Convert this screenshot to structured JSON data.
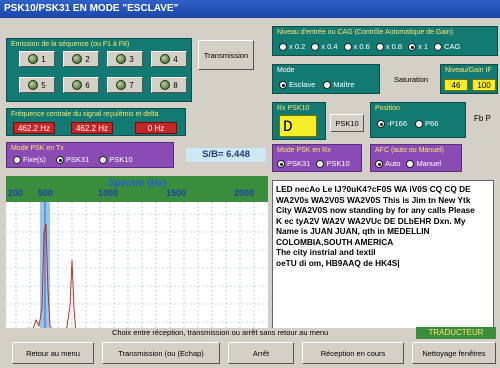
{
  "window": {
    "title": "PSK10/PSK31 EN MODE \"ESCLAVE\""
  },
  "seq": {
    "label": "Emission de la séquence (ou F1 à F8)",
    "buttons": [
      "1",
      "2",
      "3",
      "4",
      "5",
      "6",
      "7",
      "8"
    ],
    "transmission_btn": "Transmission"
  },
  "cag": {
    "label": "Niveau d'entrée ou CAG (Contrôle Automatique de Gain)",
    "options": [
      "x 0.2",
      "x 0.4",
      "x 0.6",
      "x 0.8",
      "x 1",
      "CAG"
    ],
    "selected": "x 1"
  },
  "freqpanel": {
    "label": "Fréquence centrale du signal reçu/émis et delta",
    "values": [
      "462.2 Hz",
      "462.2 Hz",
      "0 Hz"
    ]
  },
  "mode": {
    "label": "Mode",
    "options": [
      "Esclave",
      "Maître"
    ],
    "selected": "Esclave"
  },
  "saturation": "Saturation",
  "gain": {
    "label": "Niveau/Gain IF",
    "values": [
      "46",
      "100"
    ]
  },
  "rx": {
    "label": "Rx PSK10",
    "value": "D",
    "btn": "PSK10"
  },
  "position": {
    "label": "Position",
    "options": [
      "-P166",
      "P66"
    ],
    "selected": "-P166",
    "extra": "Fb P"
  },
  "txmode": {
    "label": "Mode PSK en Tx",
    "options": [
      "Fixe(s)",
      "PSK31",
      "PSK10"
    ],
    "selected": "PSK31"
  },
  "sb": "S/B= 6.448",
  "rxmode": {
    "label": "Mode PSK en Rx",
    "options": [
      "PSK31",
      "PSK10"
    ],
    "selected": "PSK31"
  },
  "afc": {
    "label": "AFC (auto ou Manuel)",
    "options": [
      "Auto",
      "Manuel"
    ],
    "selected": "Auto"
  },
  "spectre": {
    "title": "Spectre (Hz)",
    "ticks": [
      "200",
      "500",
      "1000",
      "1500",
      "2000"
    ]
  },
  "received_text": [
    "LED necAo Le IJ?0uK4?cF0S WA iV0S  CQ CQ DE",
    "WA2V0s WA2V0S WA2V0S This is Jim tn New Ytk",
    "City WA2V0S now standing by for any calls Please",
    "K ec tyA2V WA2V WA2VUc DE DLbEHR Dxn.  My",
    "Name is JUAN JUAN, qth in MEDELLIN",
    "COLOMBIA,SOUTH AMERICA",
    " The city instrial and textil",
    " oeTU di om, HB9AAQ de HK4S|"
  ],
  "bottom": {
    "hint": "Choix entre réception, transmission ou arrêt sans retour au menu",
    "traducteur": "TRADUCTEUR",
    "buttons": [
      "Retour au menu",
      "Transmission (ou (Echap)",
      "Arrêt",
      "Réception en cours",
      "Nettoyage fenêtres"
    ]
  },
  "colors": {
    "teal": "#127a72",
    "purple": "#8a4bb5",
    "spectrum_bg": "#3a8d3d",
    "graph_line": "#c81d1d"
  }
}
